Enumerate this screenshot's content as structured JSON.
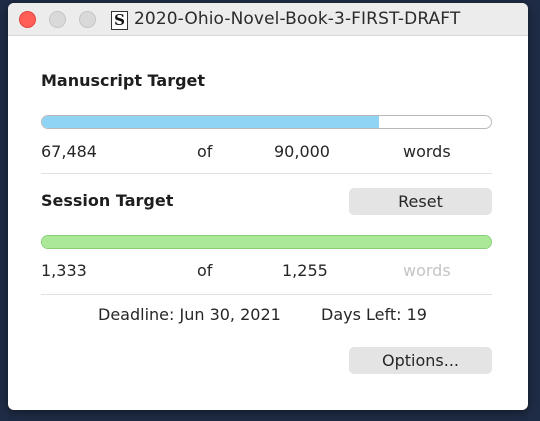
{
  "window": {
    "title": "2020-Ohio-Novel-Book-3-FIRST-DRAFT",
    "doc_icon_letter": "S"
  },
  "manuscript": {
    "heading": "Manuscript Target",
    "current": "67,484",
    "of": "of",
    "target": "90,000",
    "unit": "words",
    "progress": 0.75,
    "bar_color": "#8fd3f5"
  },
  "session": {
    "heading": "Session Target",
    "reset_label": "Reset",
    "current": "1,333",
    "of": "of",
    "target": "1,255",
    "unit": "words",
    "progress": 1.0,
    "bar_color": "#abe998"
  },
  "deadline": {
    "text": "Deadline: Jun 30, 2021",
    "days_left": "Days Left: 19"
  },
  "options_label": "Options..."
}
